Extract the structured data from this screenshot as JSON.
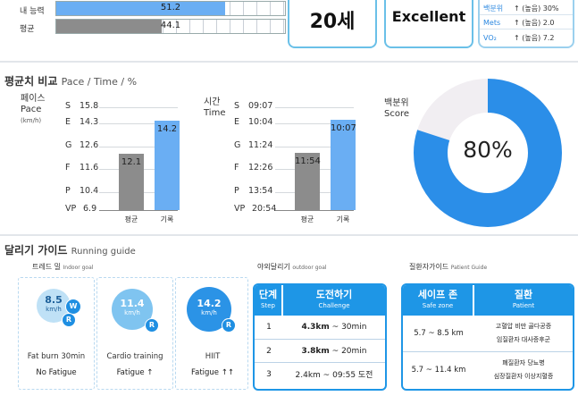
{
  "top": {
    "rows": [
      {
        "label": "내 능력",
        "value": "51.2",
        "fill_pct": 74,
        "color": "#6aaef3"
      },
      {
        "label": "평균",
        "value": "44.1",
        "fill_pct": 46,
        "color": "#8c8c8c"
      }
    ],
    "age": "20세",
    "grade": "Excellent",
    "metrics": [
      {
        "key": "백분위",
        "value": "↑ (높음) 30%"
      },
      {
        "key": "Mets",
        "value": "↑ (높음) 2.0"
      },
      {
        "key": "VO₂",
        "value": "↑ (높음) 7.2"
      }
    ]
  },
  "comparison": {
    "title": "평균치 비교",
    "title_en": "Pace / Time / %",
    "pace": {
      "label_ko": "페이스",
      "label_en": "Pace",
      "unit": "(km/h)",
      "ticks": [
        {
          "grade": "S",
          "value": "15.8"
        },
        {
          "grade": "E",
          "value": "14.3"
        },
        {
          "grade": "G",
          "value": "12.6"
        },
        {
          "grade": "F",
          "value": "11.6"
        },
        {
          "grade": "P",
          "value": "10.4"
        },
        {
          "grade": "VP",
          "value": "6.9"
        }
      ],
      "bars": [
        {
          "category": "평균",
          "value": "12.1",
          "color": "#8c8c8c"
        },
        {
          "category": "기록",
          "value": "14.2",
          "color": "#6aaef3"
        }
      ]
    },
    "time": {
      "label_ko": "시간",
      "label_en": "Time",
      "ticks": [
        {
          "grade": "S",
          "value": "09:07"
        },
        {
          "grade": "E",
          "value": "10:04"
        },
        {
          "grade": "G",
          "value": "11:24"
        },
        {
          "grade": "F",
          "value": "12:26"
        },
        {
          "grade": "P",
          "value": "13:54"
        },
        {
          "grade": "VP",
          "value": "20:54"
        }
      ],
      "bars": [
        {
          "category": "평균",
          "value": "11:54",
          "color": "#8c8c8c"
        },
        {
          "category": "기록",
          "value": "10:07",
          "color": "#6aaef3"
        }
      ]
    },
    "percentile": {
      "label_ko": "백분위",
      "label_en": "Score",
      "value": 80,
      "display": "80%",
      "color": "#2b8ee8",
      "track_color": "#f1eef2"
    }
  },
  "guide": {
    "title": "달리기 가이드",
    "title_en": "Running guide",
    "treadmill": {
      "title": "트레드 밀",
      "title_en": "Indoor goal"
    },
    "outdoor": {
      "title": "야외달리기",
      "title_en": "outdoor goal"
    },
    "patient": {
      "title": "질환자가이드",
      "title_en": "Patient Guide"
    },
    "goals": [
      {
        "speed": "8.5",
        "unit": "km/h",
        "badges": [
          "W",
          "R"
        ],
        "name": "Fat burn 30min",
        "sub": "No Fatigue",
        "color": "#bfe1f6"
      },
      {
        "speed": "11.4",
        "unit": "km/h",
        "badges": [
          "R"
        ],
        "name": "Cardio training",
        "sub": "Fatigue ↑",
        "color": "#7fc4f0"
      },
      {
        "speed": "14.2",
        "unit": "km/h",
        "badges": [
          "R"
        ],
        "name": "HIIT",
        "sub": "Fatigue ↑↑",
        "color": "#2b93e6"
      }
    ],
    "challenge": {
      "head_step": "단계",
      "head_step_en": "Step",
      "head_challenge": "도전하기",
      "head_challenge_en": "Challenge",
      "rows": [
        {
          "step": "1",
          "distance": "4.3km",
          "time": "~ 30min"
        },
        {
          "step": "2",
          "distance": "3.8km",
          "time": "~ 20min"
        },
        {
          "step": "3",
          "distance": "2.4km ~",
          "time": "09:55 도전"
        }
      ]
    },
    "safe": {
      "head_zone": "세이프 존",
      "head_zone_en": "Safe zone",
      "head_patient": "질환",
      "head_patient_en": "Patient",
      "rows": [
        {
          "zone": "5.7 ~ 8.5 km",
          "items": [
            "고혈압 비만 골다공증",
            "임질환자 대사증후군"
          ]
        },
        {
          "zone": "5.7 ~ 11.4 km",
          "items": [
            "폐질환자 당뇨병",
            "심장질환자 이상지혈증"
          ]
        }
      ]
    }
  }
}
